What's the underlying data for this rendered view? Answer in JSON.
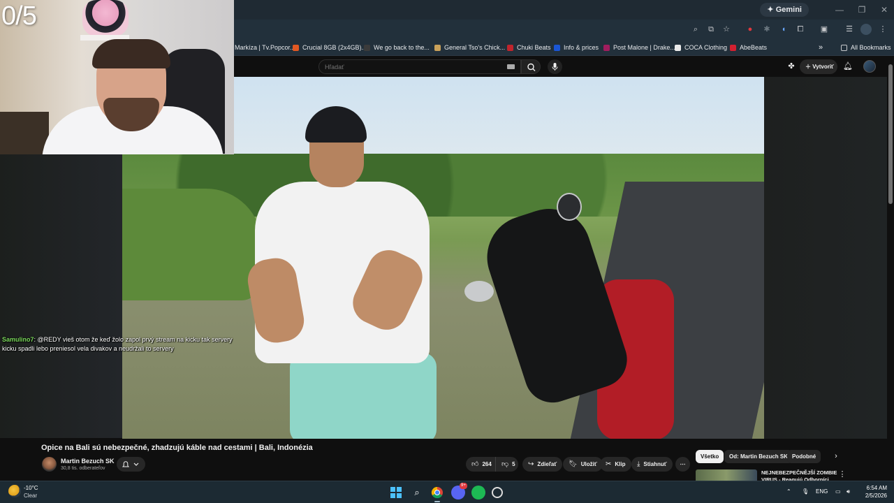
{
  "stream": {
    "counter": "0/5"
  },
  "browser": {
    "gemini_label": "Gemini",
    "bookmarks": [
      "Markíza | Tv.Popcor...",
      "Crucial 8GB (2x4GB)...",
      "We go back to the...",
      "General Tso's Chick...",
      "Chuki Beats",
      "Info & prices",
      "Post Malone | Drake...",
      "COCA Clothing",
      "AbeBeats"
    ],
    "more_bookmarks": "»",
    "all_bookmarks": "All Bookmarks"
  },
  "youtube": {
    "search_placeholder": "Hľadať",
    "create_label": "Vytvoriť"
  },
  "chat": {
    "user": "Samulino7",
    "message": ": @REDY vieš otom že keď žolo zapol prvý stream na kicku tak servery kicku spadli lebo preniesol vela divakov a neudržali to servery"
  },
  "video": {
    "title": "Opice na Bali sú nebezpečné, zhadzujú káble nad cestami | Bali, Indonézia",
    "channel": "Martin Bezuch SK",
    "subscribers": "30,8 tis. odberateľov",
    "likes": "264",
    "dislikes": "5",
    "share": "Zdieľať",
    "save": "Uložiť",
    "clip": "Klip",
    "download": "Stiahnuť",
    "more": "⋯"
  },
  "recommendations": {
    "chips": [
      "Všetko",
      "Od: Martin Bezuch SK",
      "Podobné"
    ],
    "first_title": "NEJNEBEZPEČNĚJŠÍ ZOMBIE VIRUS - Reagujú Odborníci"
  },
  "taskbar": {
    "weather_temp": "-10°C",
    "weather_desc": "Clear",
    "language": "ENG",
    "time": "6:54 AM",
    "date": "2/5/2026",
    "discord_badge": "9+"
  },
  "colors": {
    "chat_username": "#7bd95c",
    "bg": "#0f0f0f",
    "chip_active": "#f1f1f1"
  }
}
